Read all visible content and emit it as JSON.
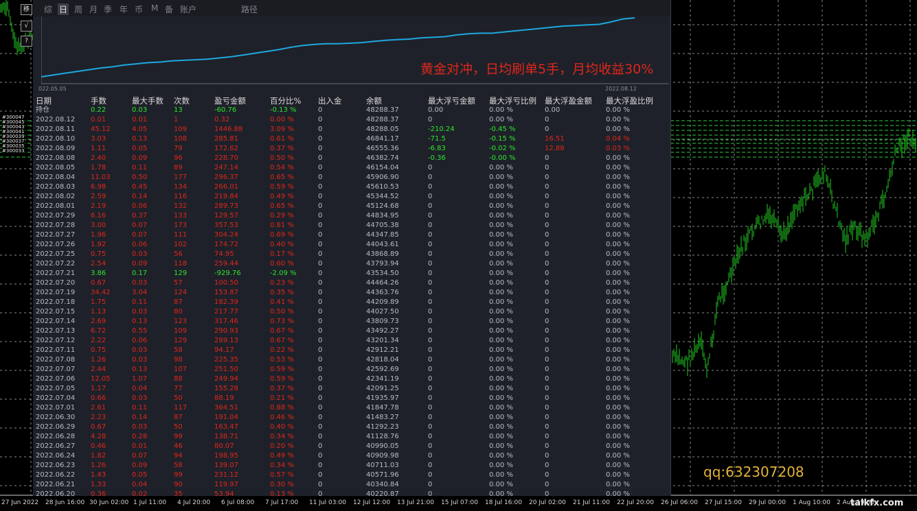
{
  "side_buttons": [
    "移",
    "√",
    "?"
  ],
  "tabs": [
    "综",
    "日",
    "周",
    "月",
    "季",
    "年",
    "币",
    "M",
    "备",
    "账户",
    "路径"
  ],
  "headline": "黄金对冲，日均刷单5手，月均收益30%",
  "equity_chart": {
    "start_label": "022.05.05",
    "end_label": "2022.08.12",
    "line_color": "#1ea7e1",
    "values": [
      0.0,
      0.03,
      0.06,
      0.09,
      0.12,
      0.15,
      0.17,
      0.2,
      0.22,
      0.24,
      0.25,
      0.27,
      0.28,
      0.29,
      0.3,
      0.32,
      0.34,
      0.37,
      0.4,
      0.43,
      0.46,
      0.5,
      0.53,
      0.55,
      0.56,
      0.56,
      0.57,
      0.58,
      0.6,
      0.62,
      0.63,
      0.64,
      0.66,
      0.67,
      0.68,
      0.71,
      0.73,
      0.74,
      0.74,
      0.76,
      0.78,
      0.8,
      0.82,
      0.84,
      0.86,
      0.87,
      0.88,
      0.89,
      0.93,
      0.98,
      1.0
    ]
  },
  "table": {
    "headers": [
      "日期",
      "手数",
      "最大手数",
      "次数",
      "盈亏金额",
      "百分比%",
      "出入金",
      "余额",
      "最大浮亏金额",
      "最大浮亏比例",
      "最大浮盈金额",
      "最大浮盈比例"
    ],
    "rows": [
      {
        "date": "持仓",
        "lots": "0.22",
        "max_lots": "0.03",
        "count": "13",
        "pnl": "-60.76",
        "pct": "-0.13 %",
        "dep": "0",
        "bal": "48288.37",
        "mfa": "0.00",
        "mfr": "0.00 %",
        "mga": "0.00",
        "mgr": "0.00 %",
        "tone": "green"
      },
      {
        "date": "2022.08.12",
        "lots": "0.01",
        "max_lots": "0.01",
        "count": "1",
        "pnl": "0.32",
        "pct": "0.00 %",
        "dep": "0",
        "bal": "48288.37",
        "mfa": "0",
        "mfr": "0.00 %",
        "mga": "0",
        "mgr": "0.00 %",
        "tone": "red"
      },
      {
        "date": "2022.08.11",
        "lots": "45.12",
        "max_lots": "4.05",
        "count": "109",
        "pnl": "1446.88",
        "pct": "3.09 %",
        "dep": "0",
        "bal": "48288.05",
        "mfa": "-210.24",
        "mfr": "-0.45 %",
        "mga": "0",
        "mgr": "0.00 %",
        "tone": "red"
      },
      {
        "date": "2022.08.10",
        "lots": "3.03",
        "max_lots": "0.13",
        "count": "108",
        "pnl": "285.81",
        "pct": "0.61 %",
        "dep": "0",
        "bal": "46841.17",
        "mfa": "-71.5",
        "mfr": "-0.15 %",
        "mga": "16.51",
        "mgr": "0.04 %",
        "tone": "red"
      },
      {
        "date": "2022.08.09",
        "lots": "1.11",
        "max_lots": "0.05",
        "count": "79",
        "pnl": "172.62",
        "pct": "0.37 %",
        "dep": "0",
        "bal": "46555.36",
        "mfa": "-6.83",
        "mfr": "-0.02 %",
        "mga": "12.88",
        "mgr": "0.03 %",
        "tone": "red"
      },
      {
        "date": "2022.08.08",
        "lots": "2.40",
        "max_lots": "0.09",
        "count": "96",
        "pnl": "228.70",
        "pct": "0.50 %",
        "dep": "0",
        "bal": "46382.74",
        "mfa": "-0.36",
        "mfr": "-0.00 %",
        "mga": "0",
        "mgr": "0.00 %",
        "tone": "red"
      },
      {
        "date": "2022.08.05",
        "lots": "1.78",
        "max_lots": "0.11",
        "count": "89",
        "pnl": "247.14",
        "pct": "0.54 %",
        "dep": "0",
        "bal": "46154.04",
        "mfa": "0",
        "mfr": "0.00 %",
        "mga": "0",
        "mgr": "0.00 %",
        "tone": "red"
      },
      {
        "date": "2022.08.04",
        "lots": "11.03",
        "max_lots": "0.50",
        "count": "177",
        "pnl": "296.37",
        "pct": "0.65 %",
        "dep": "0",
        "bal": "45906.90",
        "mfa": "0",
        "mfr": "0.00 %",
        "mga": "0",
        "mgr": "0.00 %",
        "tone": "red"
      },
      {
        "date": "2022.08.03",
        "lots": "6.98",
        "max_lots": "0.45",
        "count": "134",
        "pnl": "266.01",
        "pct": "0.59 %",
        "dep": "0",
        "bal": "45610.53",
        "mfa": "0",
        "mfr": "0.00 %",
        "mga": "0",
        "mgr": "0.00 %",
        "tone": "red"
      },
      {
        "date": "2022.08.02",
        "lots": "2.59",
        "max_lots": "0.14",
        "count": "116",
        "pnl": "219.84",
        "pct": "0.49 %",
        "dep": "0",
        "bal": "45344.52",
        "mfa": "0",
        "mfr": "0.00 %",
        "mga": "0",
        "mgr": "0.00 %",
        "tone": "red"
      },
      {
        "date": "2022.08.01",
        "lots": "2.19",
        "max_lots": "0.06",
        "count": "132",
        "pnl": "289.73",
        "pct": "0.65 %",
        "dep": "0",
        "bal": "45124.68",
        "mfa": "0",
        "mfr": "0.00 %",
        "mga": "0",
        "mgr": "0.00 %",
        "tone": "red"
      },
      {
        "date": "2022.07.29",
        "lots": "6.16",
        "max_lots": "0.37",
        "count": "133",
        "pnl": "129.57",
        "pct": "0.29 %",
        "dep": "0",
        "bal": "44834.95",
        "mfa": "0",
        "mfr": "0.00 %",
        "mga": "0",
        "mgr": "0.00 %",
        "tone": "red"
      },
      {
        "date": "2022.07.28",
        "lots": "3.00",
        "max_lots": "0.07",
        "count": "173",
        "pnl": "357.53",
        "pct": "0.81 %",
        "dep": "0",
        "bal": "44705.38",
        "mfa": "0",
        "mfr": "0.00 %",
        "mga": "0",
        "mgr": "0.00 %",
        "tone": "red"
      },
      {
        "date": "2022.07.27",
        "lots": "1.96",
        "max_lots": "0.07",
        "count": "111",
        "pnl": "304.24",
        "pct": "0.69 %",
        "dep": "0",
        "bal": "44347.85",
        "mfa": "0",
        "mfr": "0.00 %",
        "mga": "0",
        "mgr": "0.00 %",
        "tone": "red"
      },
      {
        "date": "2022.07.26",
        "lots": "1.92",
        "max_lots": "0.06",
        "count": "102",
        "pnl": "174.72",
        "pct": "0.40 %",
        "dep": "0",
        "bal": "44043.61",
        "mfa": "0",
        "mfr": "0.00 %",
        "mga": "0",
        "mgr": "0.00 %",
        "tone": "red"
      },
      {
        "date": "2022.07.25",
        "lots": "0.75",
        "max_lots": "0.03",
        "count": "56",
        "pnl": "74.95",
        "pct": "0.17 %",
        "dep": "0",
        "bal": "43868.89",
        "mfa": "0",
        "mfr": "0.00 %",
        "mga": "0",
        "mgr": "0.00 %",
        "tone": "red"
      },
      {
        "date": "2022.07.22",
        "lots": "2.54",
        "max_lots": "0.09",
        "count": "118",
        "pnl": "259.44",
        "pct": "0.60 %",
        "dep": "0",
        "bal": "43793.94",
        "mfa": "0",
        "mfr": "0.00 %",
        "mga": "0",
        "mgr": "0.00 %",
        "tone": "red"
      },
      {
        "date": "2022.07.21",
        "lots": "3.86",
        "max_lots": "0.17",
        "count": "129",
        "pnl": "-929.76",
        "pct": "-2.09 %",
        "dep": "0",
        "bal": "43534.50",
        "mfa": "0",
        "mfr": "0.00 %",
        "mga": "0",
        "mgr": "0.00 %",
        "tone": "green"
      },
      {
        "date": "2022.07.20",
        "lots": "0.67",
        "max_lots": "0.03",
        "count": "57",
        "pnl": "100.50",
        "pct": "0.23 %",
        "dep": "0",
        "bal": "44464.26",
        "mfa": "0",
        "mfr": "0.00 %",
        "mga": "0",
        "mgr": "0.00 %",
        "tone": "red"
      },
      {
        "date": "2022.07.19",
        "lots": "34.42",
        "max_lots": "3.04",
        "count": "124",
        "pnl": "153.87",
        "pct": "0.35 %",
        "dep": "0",
        "bal": "44363.76",
        "mfa": "0",
        "mfr": "0.00 %",
        "mga": "0",
        "mgr": "0.00 %",
        "tone": "red"
      },
      {
        "date": "2022.07.18",
        "lots": "1.75",
        "max_lots": "0.11",
        "count": "87",
        "pnl": "182.39",
        "pct": "0.41 %",
        "dep": "0",
        "bal": "44209.89",
        "mfa": "0",
        "mfr": "0.00 %",
        "mga": "0",
        "mgr": "0.00 %",
        "tone": "red"
      },
      {
        "date": "2022.07.15",
        "lots": "1.13",
        "max_lots": "0.03",
        "count": "80",
        "pnl": "217.77",
        "pct": "0.50 %",
        "dep": "0",
        "bal": "44027.50",
        "mfa": "0",
        "mfr": "0.00 %",
        "mga": "0",
        "mgr": "0.00 %",
        "tone": "red"
      },
      {
        "date": "2022.07.14",
        "lots": "2.69",
        "max_lots": "0.13",
        "count": "123",
        "pnl": "317.46",
        "pct": "0.73 %",
        "dep": "0",
        "bal": "43809.73",
        "mfa": "0",
        "mfr": "0.00 %",
        "mga": "0",
        "mgr": "0.00 %",
        "tone": "red"
      },
      {
        "date": "2022.07.13",
        "lots": "6.72",
        "max_lots": "0.55",
        "count": "109",
        "pnl": "290.93",
        "pct": "0.67 %",
        "dep": "0",
        "bal": "43492.27",
        "mfa": "0",
        "mfr": "0.00 %",
        "mga": "0",
        "mgr": "0.00 %",
        "tone": "red"
      },
      {
        "date": "2022.07.12",
        "lots": "2.22",
        "max_lots": "0.06",
        "count": "129",
        "pnl": "289.13",
        "pct": "0.67 %",
        "dep": "0",
        "bal": "43201.34",
        "mfa": "0",
        "mfr": "0.00 %",
        "mga": "0",
        "mgr": "0.00 %",
        "tone": "red"
      },
      {
        "date": "2022.07.11",
        "lots": "0.75",
        "max_lots": "0.03",
        "count": "58",
        "pnl": "94.17",
        "pct": "0.22 %",
        "dep": "0",
        "bal": "42912.21",
        "mfa": "0",
        "mfr": "0.00 %",
        "mga": "0",
        "mgr": "0.00 %",
        "tone": "red"
      },
      {
        "date": "2022.07.08",
        "lots": "1.26",
        "max_lots": "0.03",
        "count": "98",
        "pnl": "225.35",
        "pct": "0.53 %",
        "dep": "0",
        "bal": "42818.04",
        "mfa": "0",
        "mfr": "0.00 %",
        "mga": "0",
        "mgr": "0.00 %",
        "tone": "red"
      },
      {
        "date": "2022.07.07",
        "lots": "2.44",
        "max_lots": "0.13",
        "count": "107",
        "pnl": "251.50",
        "pct": "0.59 %",
        "dep": "0",
        "bal": "42592.69",
        "mfa": "0",
        "mfr": "0.00 %",
        "mga": "0",
        "mgr": "0.00 %",
        "tone": "red"
      },
      {
        "date": "2022.07.06",
        "lots": "12.05",
        "max_lots": "1.07",
        "count": "88",
        "pnl": "249.94",
        "pct": "0.59 %",
        "dep": "0",
        "bal": "42341.19",
        "mfa": "0",
        "mfr": "0.00 %",
        "mga": "0",
        "mgr": "0.00 %",
        "tone": "red"
      },
      {
        "date": "2022.07.05",
        "lots": "1.17",
        "max_lots": "0.04",
        "count": "77",
        "pnl": "155.28",
        "pct": "0.37 %",
        "dep": "0",
        "bal": "42091.25",
        "mfa": "0",
        "mfr": "0.00 %",
        "mga": "0",
        "mgr": "0.00 %",
        "tone": "red"
      },
      {
        "date": "2022.07.04",
        "lots": "0.66",
        "max_lots": "0.03",
        "count": "50",
        "pnl": "88.19",
        "pct": "0.21 %",
        "dep": "0",
        "bal": "41935.97",
        "mfa": "0",
        "mfr": "0.00 %",
        "mga": "0",
        "mgr": "0.00 %",
        "tone": "red"
      },
      {
        "date": "2022.07.01",
        "lots": "2.61",
        "max_lots": "0.11",
        "count": "117",
        "pnl": "364.51",
        "pct": "0.88 %",
        "dep": "0",
        "bal": "41847.78",
        "mfa": "0",
        "mfr": "0.00 %",
        "mga": "0",
        "mgr": "0.00 %",
        "tone": "red"
      },
      {
        "date": "2022.06.30",
        "lots": "2.23",
        "max_lots": "0.14",
        "count": "87",
        "pnl": "191.04",
        "pct": "0.46 %",
        "dep": "0",
        "bal": "41483.27",
        "mfa": "0",
        "mfr": "0.00 %",
        "mga": "0",
        "mgr": "0.00 %",
        "tone": "red"
      },
      {
        "date": "2022.06.29",
        "lots": "0.67",
        "max_lots": "0.03",
        "count": "50",
        "pnl": "163.47",
        "pct": "0.40 %",
        "dep": "0",
        "bal": "41292.23",
        "mfa": "0",
        "mfr": "0.00 %",
        "mga": "0",
        "mgr": "0.00 %",
        "tone": "red"
      },
      {
        "date": "2022.06.28",
        "lots": "4.28",
        "max_lots": "0.28",
        "count": "99",
        "pnl": "138.71",
        "pct": "0.34 %",
        "dep": "0",
        "bal": "41128.76",
        "mfa": "0",
        "mfr": "0.00 %",
        "mga": "0",
        "mgr": "0.00 %",
        "tone": "red"
      },
      {
        "date": "2022.06.27",
        "lots": "0.46",
        "max_lots": "0.01",
        "count": "46",
        "pnl": "80.07",
        "pct": "0.20 %",
        "dep": "0",
        "bal": "40990.05",
        "mfa": "0",
        "mfr": "0.00 %",
        "mga": "0",
        "mgr": "0.00 %",
        "tone": "red"
      },
      {
        "date": "2022.06.24",
        "lots": "1.82",
        "max_lots": "0.07",
        "count": "94",
        "pnl": "198.95",
        "pct": "0.49 %",
        "dep": "0",
        "bal": "40909.98",
        "mfa": "0",
        "mfr": "0.00 %",
        "mga": "0",
        "mgr": "0.00 %",
        "tone": "red"
      },
      {
        "date": "2022.06.23",
        "lots": "1.26",
        "max_lots": "0.09",
        "count": "58",
        "pnl": "139.07",
        "pct": "0.34 %",
        "dep": "0",
        "bal": "40711.03",
        "mfa": "0",
        "mfr": "0.00 %",
        "mga": "0",
        "mgr": "0.00 %",
        "tone": "red"
      },
      {
        "date": "2022.06.22",
        "lots": "1.43",
        "max_lots": "0.05",
        "count": "99",
        "pnl": "231.12",
        "pct": "0.57 %",
        "dep": "0",
        "bal": "40571.96",
        "mfa": "0",
        "mfr": "0.00 %",
        "mga": "0",
        "mgr": "0.00 %",
        "tone": "red"
      },
      {
        "date": "2022.06.21",
        "lots": "1.33",
        "max_lots": "0.04",
        "count": "90",
        "pnl": "119.97",
        "pct": "0.30 %",
        "dep": "0",
        "bal": "40340.84",
        "mfa": "0",
        "mfr": "0.00 %",
        "mga": "0",
        "mgr": "0.00 %",
        "tone": "red"
      },
      {
        "date": "2022.06.20",
        "lots": "0.36",
        "max_lots": "0.02",
        "count": "35",
        "pnl": "53.94",
        "pct": "0.13 %",
        "dep": "0",
        "bal": "40220.87",
        "mfa": "0",
        "mfr": "0.00 %",
        "mga": "0",
        "mgr": "0.00 %",
        "tone": "red"
      }
    ]
  },
  "time_axis": [
    "27 Jun 2022",
    "28 Jun 16:00",
    "30 Jun 02:00",
    "1 Jul 11:00",
    "4 Jul 20:00",
    "6 Jul 08:00",
    "7 Jul 17:00",
    "11 Jul 03:00",
    "12 Jul 12:00",
    "13 Jul 21:00",
    "15 Jul 07:00",
    "18 Jul 16:00",
    "20 Jul 02:00",
    "21 Jul 11:00",
    "22 Jul 20:00",
    "26 Jul 06:00",
    "27 Jul 15:00",
    "29 Jul 00:00",
    "1 Aug 10:00",
    "2 Aug 19:00"
  ],
  "price_levels": [
    "#300047",
    "#300045",
    "#300043",
    "#300041",
    "#300039",
    "#300037",
    "#300035",
    "#300033"
  ],
  "contact": "qq:632307208",
  "watermark": "talkfx.com",
  "colors": {
    "profit": "#e0261c",
    "loss": "#2ee62e",
    "candle": "#22cc22",
    "level": "#2ecc40",
    "panel_bg": "#1e2129"
  }
}
